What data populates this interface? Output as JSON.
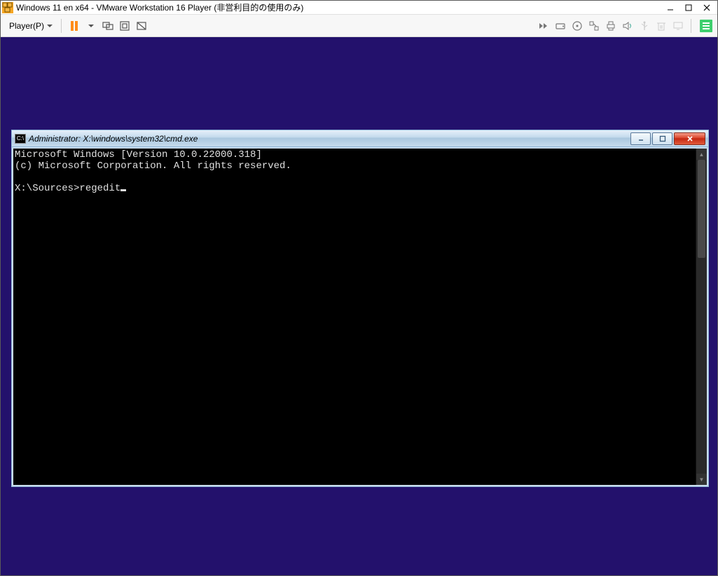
{
  "vmware": {
    "title": "Windows 11 en x64 - VMware Workstation 16 Player (非営利目的の使用のみ)",
    "player_menu": "Player(P)"
  },
  "cmd": {
    "title": "Administrator: X:\\windows\\system32\\cmd.exe",
    "line1": "Microsoft Windows [Version 10.0.22000.318]",
    "line2": "(c) Microsoft Corporation. All rights reserved.",
    "prompt": "X:\\Sources>",
    "input": "regedit"
  }
}
